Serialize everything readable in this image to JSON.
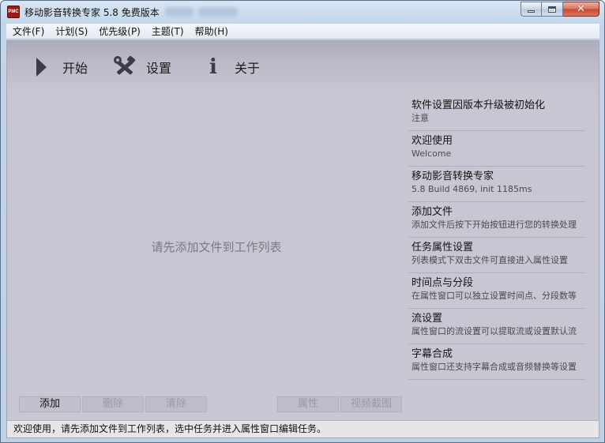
{
  "window": {
    "title": "移动影音转换专家 5.8 免费版本",
    "icon_text": "PMC"
  },
  "menu": [
    {
      "label": "文件(F)"
    },
    {
      "label": "计划(S)"
    },
    {
      "label": "优先级(P)"
    },
    {
      "label": "主题(T)"
    },
    {
      "label": "帮助(H)"
    }
  ],
  "toolbar": {
    "start_label": "开始",
    "settings_label": "设置",
    "about_label": "关于"
  },
  "main": {
    "empty_hint": "请先添加文件到工作列表"
  },
  "info_panel": [
    {
      "title": "软件设置因版本升级被初始化",
      "subtitle": "注意"
    },
    {
      "title": "欢迎使用",
      "subtitle": "Welcome"
    },
    {
      "title": "移动影音转换专家",
      "subtitle": "5.8 Build 4869, init 1185ms"
    },
    {
      "title": "添加文件",
      "subtitle": "添加文件后按下开始按钮进行您的转换处理"
    },
    {
      "title": "任务属性设置",
      "subtitle": "列表模式下双击文件可直接进入属性设置"
    },
    {
      "title": "时间点与分段",
      "subtitle": "在属性窗口可以独立设置时间点、分段数等"
    },
    {
      "title": "流设置",
      "subtitle": "属性窗口的流设置可以提取流或设置默认流"
    },
    {
      "title": "字幕合成",
      "subtitle": "属性窗口还支持字幕合成或音频替换等设置"
    }
  ],
  "actions": {
    "add": "添加",
    "delete": "删除",
    "clear": "清除",
    "properties": "属性",
    "snapshot": "视频截图"
  },
  "status": {
    "text": "欢迎使用，请先添加文件到工作列表，选中任务并进入属性窗口编辑任务。"
  },
  "icons": {
    "start": "play-icon",
    "settings": "tools-icon",
    "about": "info-icon",
    "minimize": "minimize-icon",
    "maximize": "maximize-icon",
    "close": "close-icon"
  }
}
